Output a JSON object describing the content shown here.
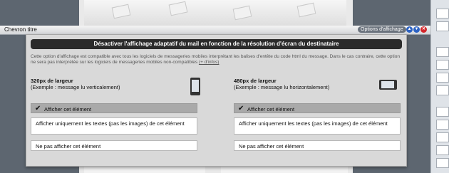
{
  "header": {
    "title": "Chevron titre",
    "options_button": "Options d'affichage",
    "icons": [
      "move-up-icon",
      "move-down-icon",
      "close-icon"
    ]
  },
  "dialog": {
    "title": "Désactiver l'affichage adaptatif du mail en fonction de la résolution d'écran du destinataire",
    "description": "Cette option d'affichage est compatible avec tous les logiciels de messageries mobiles interprétant les balises d'entête du code html du message. Dans le cas contraire, cette option ne sera pas interprétée sur les logiciels de messageries mobiles non-compatibles",
    "more_link": "(+ d'infos)",
    "columns": [
      {
        "width_label": "320px de largeur",
        "example_label": "(Exemple : message lu verticalement)",
        "device_icon": "phone-portrait-icon",
        "options": [
          {
            "label": "Afficher cet élément",
            "selected": true
          },
          {
            "label": "Afficher uniquement les textes (pas les images) de cet élément",
            "selected": false
          },
          {
            "label": "Ne pas afficher cet élément",
            "selected": false
          }
        ]
      },
      {
        "width_label": "480px de largeur",
        "example_label": "(Exemple : message lu horizontalement)",
        "device_icon": "phone-landscape-icon",
        "options": [
          {
            "label": "Afficher cet élément",
            "selected": true
          },
          {
            "label": "Afficher uniquement les textes (pas les images) de cet élément",
            "selected": false
          },
          {
            "label": "Ne pas afficher cet élément",
            "selected": false
          }
        ]
      }
    ]
  },
  "colors": {
    "title_bar": "#2b2b2b",
    "dialog_bg": "#d9d9d9",
    "selected_option": "#a9a9a9",
    "close_icon": "#d3262b",
    "nav_icon": "#2d63c4"
  }
}
